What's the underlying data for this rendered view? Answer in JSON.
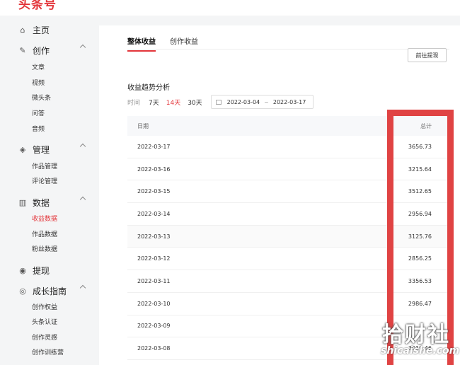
{
  "app": {
    "logo": "头条号"
  },
  "sidebar": {
    "home": "主页",
    "create": {
      "label": "创作",
      "items": [
        "文章",
        "视频",
        "微头条",
        "问答",
        "音频"
      ]
    },
    "manage": {
      "label": "管理",
      "items": [
        "作品管理",
        "评论管理"
      ]
    },
    "data": {
      "label": "数据",
      "items": [
        "收益数据",
        "作品数据",
        "粉丝数据"
      ],
      "active_index": 0
    },
    "withdraw": "提现",
    "growth": {
      "label": "成长指南",
      "items": [
        "创作权益",
        "头条认证",
        "创作灵感",
        "创作训练营"
      ]
    }
  },
  "tabs": [
    "整体收益",
    "创作收益"
  ],
  "active_tab": 0,
  "withdraw_button": "前往提现",
  "section_title": "收益趋势分析",
  "filter": {
    "label": "时间",
    "ranges": [
      "7天",
      "14天",
      "30天"
    ],
    "active_range": 1,
    "start_date": "2022-03-04",
    "separator": "~",
    "end_date": "2022-03-17"
  },
  "table": {
    "headers": {
      "date": "日期",
      "total": "总计"
    },
    "rows": [
      {
        "date": "2022-03-17",
        "total": "3656.73"
      },
      {
        "date": "2022-03-16",
        "total": "3215.64"
      },
      {
        "date": "2022-03-15",
        "total": "3512.65"
      },
      {
        "date": "2022-03-14",
        "total": "2956.94"
      },
      {
        "date": "2022-03-13",
        "total": "3125.76"
      },
      {
        "date": "2022-03-12",
        "total": "2856.25"
      },
      {
        "date": "2022-03-11",
        "total": "3356.53"
      },
      {
        "date": "2022-03-10",
        "total": "2986.47"
      },
      {
        "date": "2022-03-09",
        "total": ""
      },
      {
        "date": "2022-03-08",
        "total": "3019.46"
      }
    ]
  },
  "watermark": {
    "main": "拾财社",
    "domain": "shicaishe.com"
  },
  "colors": {
    "accent": "#e3353a",
    "highlight": "#e04343"
  }
}
